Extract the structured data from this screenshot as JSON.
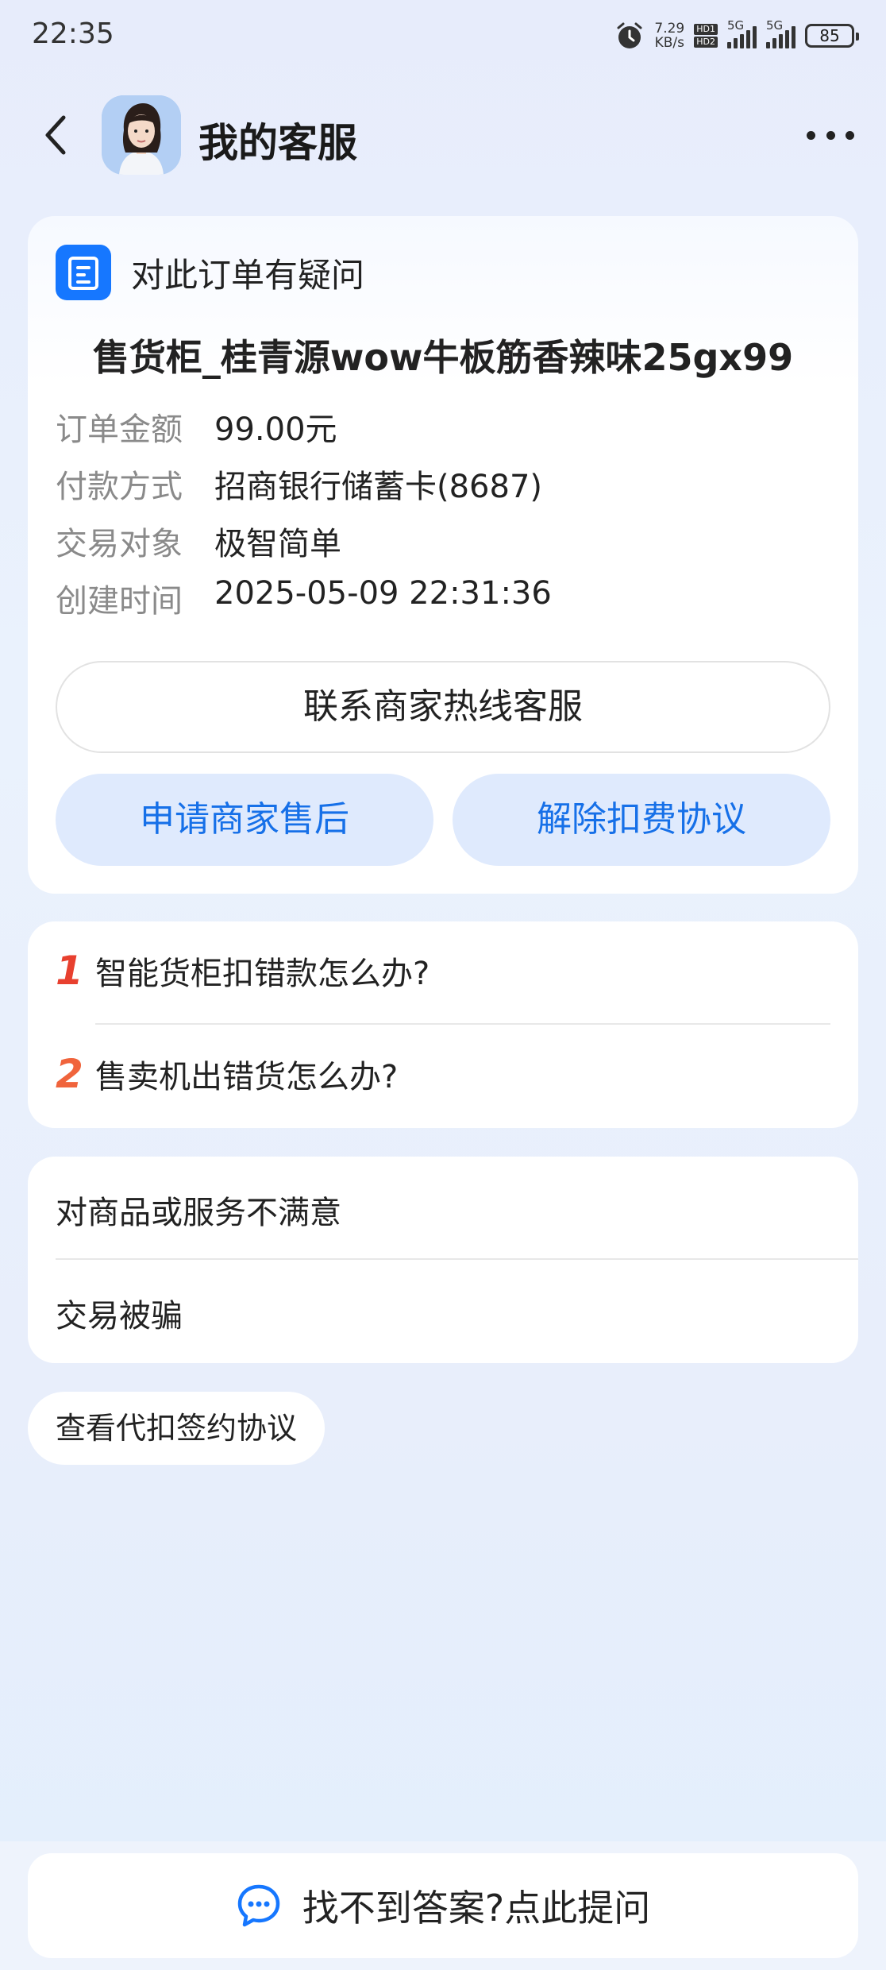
{
  "status_bar": {
    "time": "22:35",
    "net_speed_value": "7.29",
    "net_speed_unit": "KB/s",
    "hd1": "HD1",
    "hd2": "HD2",
    "signal1_label": "5G",
    "signal2_label": "5G",
    "battery": "85"
  },
  "header": {
    "title": "我的客服"
  },
  "order": {
    "heading": "对此订单有疑问",
    "product_name": "售货柜_桂青源wow牛板筋香辣味25gx99",
    "fields": [
      {
        "label": "订单金额",
        "value": "99.00元"
      },
      {
        "label": "付款方式",
        "value": "招商银行储蓄卡(8687)"
      },
      {
        "label": "交易对象",
        "value": "极智简单"
      },
      {
        "label": "创建时间",
        "value": "2025-05-09 22:31:36"
      }
    ],
    "hotline_button": "联系商家热线客服",
    "after_sale_button": "申请商家售后",
    "cancel_agreement_button": "解除扣费协议"
  },
  "faq": {
    "items": [
      {
        "num": "1",
        "text": "智能货柜扣错款怎么办?",
        "color": "#e8402f"
      },
      {
        "num": "2",
        "text": "售卖机出错货怎么办?",
        "color": "#f0643c"
      }
    ]
  },
  "issues": {
    "items": [
      "对商品或服务不满意",
      "交易被骗"
    ]
  },
  "agreement_link": "查看代扣签约协议",
  "bottom": {
    "ask_label": "找不到答案?点此提问"
  },
  "colors": {
    "accent": "#1677ff",
    "soft_button_bg": "#dfeafd",
    "soft_button_text": "#1670e8"
  }
}
